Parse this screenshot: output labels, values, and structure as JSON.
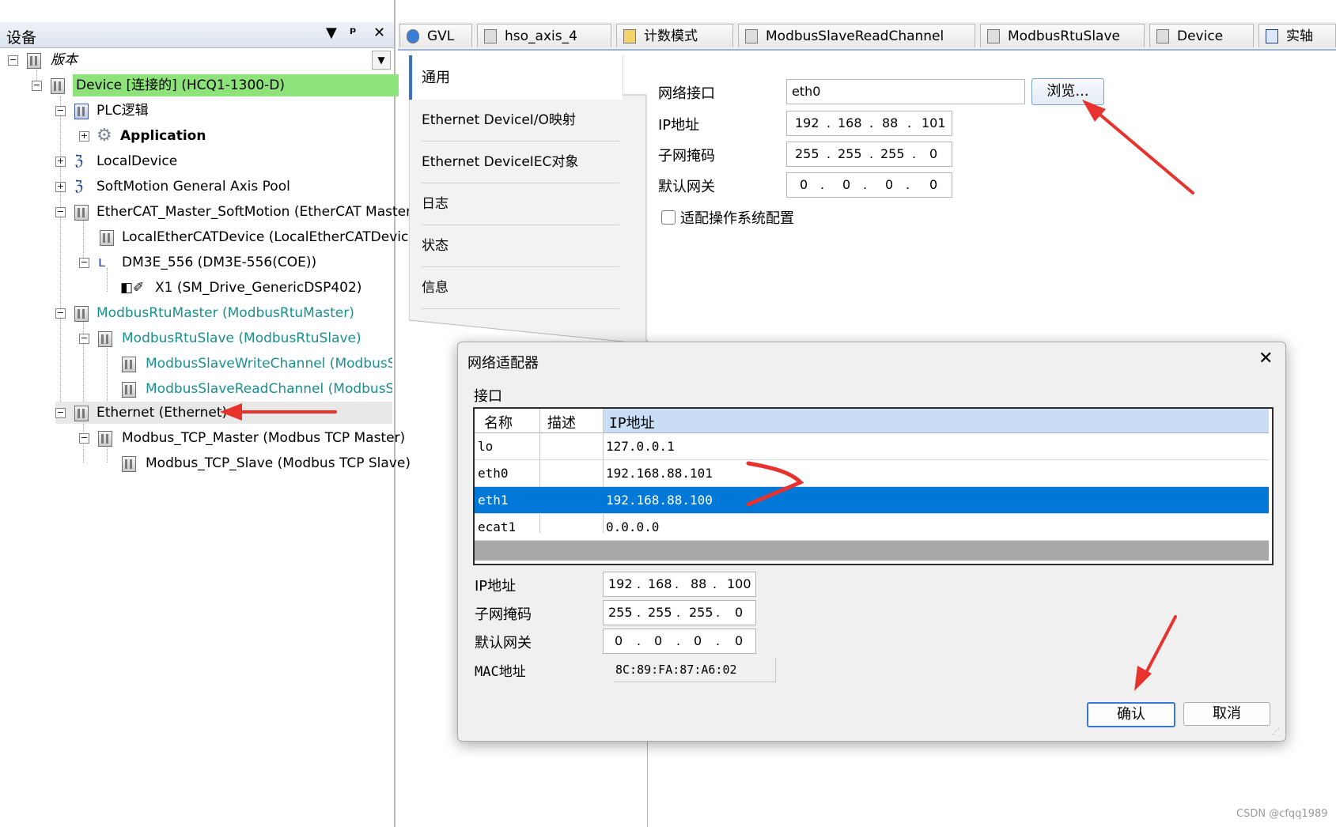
{
  "left_panel": {
    "title": "设备",
    "dropdown_glyph": "▼",
    "pin_glyph": "ꟷ",
    "close_glyph": "✕",
    "tree": [
      {
        "label": "版本",
        "style": "italic"
      },
      {
        "label": "Device [连接的] (HCQ1-1300-D)",
        "style": "highlight"
      },
      {
        "label": "PLC逻辑",
        "style": "normal"
      },
      {
        "label": "Application",
        "style": "bold"
      },
      {
        "label": "LocalDevice",
        "style": "normal"
      },
      {
        "label": "SoftMotion General Axis Pool",
        "style": "normal"
      },
      {
        "label": "EtherCAT_Master_SoftMotion (EtherCAT Master Sof",
        "style": "normal"
      },
      {
        "label": "LocalEtherCATDevice (LocalEtherCATDevice)",
        "style": "normal"
      },
      {
        "label": "DM3E_556 (DM3E-556(COE))",
        "style": "normal"
      },
      {
        "label": "X1 (SM_Drive_GenericDSP402)",
        "style": "normal"
      },
      {
        "label": "ModbusRtuMaster (ModbusRtuMaster)",
        "style": "teal"
      },
      {
        "label": "ModbusRtuSlave (ModbusRtuSlave)",
        "style": "teal"
      },
      {
        "label": "ModbusSlaveWriteChannel (ModbusSlaveWr",
        "style": "teal"
      },
      {
        "label": "ModbusSlaveReadChannel (ModbusSlaveRe",
        "style": "teal"
      },
      {
        "label": "Ethernet (Ethernet)",
        "style": "selected"
      },
      {
        "label": "Modbus_TCP_Master (Modbus TCP Master)",
        "style": "normal"
      },
      {
        "label": "Modbus_TCP_Slave (Modbus TCP Slave)",
        "style": "normal"
      }
    ]
  },
  "tabs": [
    "GVL",
    "hso_axis_4",
    "计数模式",
    "ModbusSlaveReadChannel",
    "ModbusRtuSlave",
    "Device",
    "实轴"
  ],
  "editor": {
    "nav": [
      "通用",
      "Ethernet DeviceI/O映射",
      "Ethernet DeviceIEC对象",
      "日志",
      "状态",
      "信息"
    ],
    "network_interface_label": "网络接口",
    "network_interface_value": "eth0",
    "browse_button": "浏览...",
    "ip_label": "IP地址",
    "ip": [
      "192",
      "168",
      "88",
      "101"
    ],
    "subnet_label": "子网掩码",
    "subnet": [
      "255",
      "255",
      "255",
      "0"
    ],
    "gateway_label": "默认网关",
    "gateway": [
      "0",
      "0",
      "0",
      "0"
    ],
    "adapt_os_label": "适配操作系统配置"
  },
  "dialog": {
    "title": "网络适配器",
    "close_glyph": "✕",
    "section_label": "接口",
    "columns": [
      "名称",
      "描述",
      "IP地址"
    ],
    "rows": [
      {
        "name": "lo",
        "desc": "",
        "ip": "127.0.0.1"
      },
      {
        "name": "eth0",
        "desc": "",
        "ip": "192.168.88.101"
      },
      {
        "name": "eth1",
        "desc": "",
        "ip": "192.168.88.100"
      },
      {
        "name": "ecat1",
        "desc": "",
        "ip": "0.0.0.0"
      }
    ],
    "selected_row": 2,
    "ip_label": "IP地址",
    "ip": [
      "192",
      "168",
      "88",
      "100"
    ],
    "subnet_label": "子网掩码",
    "subnet": [
      "255",
      "255",
      "255",
      "0"
    ],
    "gateway_label": "默认网关",
    "gateway": [
      "0",
      "0",
      "0",
      "0"
    ],
    "mac_label": "MAC地址",
    "mac_value": "8C:89:FA:87:A6:02",
    "ok_button": "确认",
    "cancel_button": "取消"
  },
  "watermark": "CSDN @cfqq1989",
  "colors": {
    "accent": "#0078d7",
    "annotation": "#e8322d",
    "highlight": "#8ee27a",
    "teal": "#1a8f8f"
  }
}
